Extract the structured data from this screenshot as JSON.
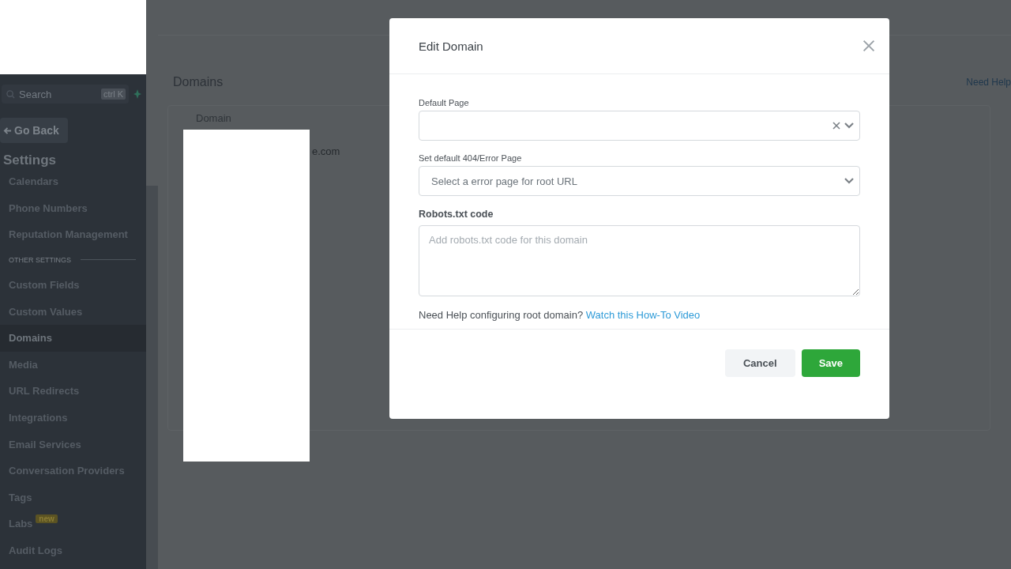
{
  "sidebar": {
    "search": {
      "placeholder": "Search",
      "shortcut": "ctrl K"
    },
    "back_button": "Go Back",
    "heading": "Settings",
    "items": [
      {
        "kind": "item",
        "label": "Calendars",
        "selected": false
      },
      {
        "kind": "item",
        "label": "Phone Numbers",
        "selected": false
      },
      {
        "kind": "item",
        "label": "Reputation Management",
        "selected": false
      },
      {
        "kind": "section",
        "label": "OTHER SETTINGS"
      },
      {
        "kind": "item",
        "label": "Custom Fields",
        "selected": false
      },
      {
        "kind": "item",
        "label": "Custom Values",
        "selected": false
      },
      {
        "kind": "item",
        "label": "Domains",
        "selected": true
      },
      {
        "kind": "item",
        "label": "Media",
        "selected": false
      },
      {
        "kind": "item",
        "label": "URL Redirects",
        "selected": false
      },
      {
        "kind": "item",
        "label": "Integrations",
        "selected": false
      },
      {
        "kind": "item",
        "label": "Email Services",
        "selected": false
      },
      {
        "kind": "item",
        "label": "Conversation Providers",
        "selected": false
      },
      {
        "kind": "item",
        "label": "Tags",
        "selected": false
      },
      {
        "kind": "item",
        "label": "Labs",
        "selected": false,
        "badge": "new"
      },
      {
        "kind": "item",
        "label": "Audit Logs",
        "selected": false
      }
    ]
  },
  "page": {
    "title": "Domains",
    "help_link": "Need Help",
    "table": {
      "columns": [
        "Domain"
      ],
      "rows": [
        [
          "e.com"
        ]
      ]
    }
  },
  "modal": {
    "title": "Edit Domain",
    "fields": [
      {
        "kind": "select",
        "label": "Default Page",
        "clearable": true
      },
      {
        "kind": "select",
        "label": "Set default 404/Error Page",
        "placeholder": "Select a error page for root URL",
        "clearable": false
      },
      {
        "kind": "textarea",
        "label": "Robots.txt code",
        "placeholder": "Add robots.txt code for this domain"
      }
    ],
    "help_text": "Need Help configuring root domain?",
    "help_link": "Watch this How-To Video",
    "buttons": [
      {
        "kind": "secondary",
        "label": "Cancel"
      },
      {
        "kind": "primary",
        "label": "Save"
      }
    ]
  }
}
